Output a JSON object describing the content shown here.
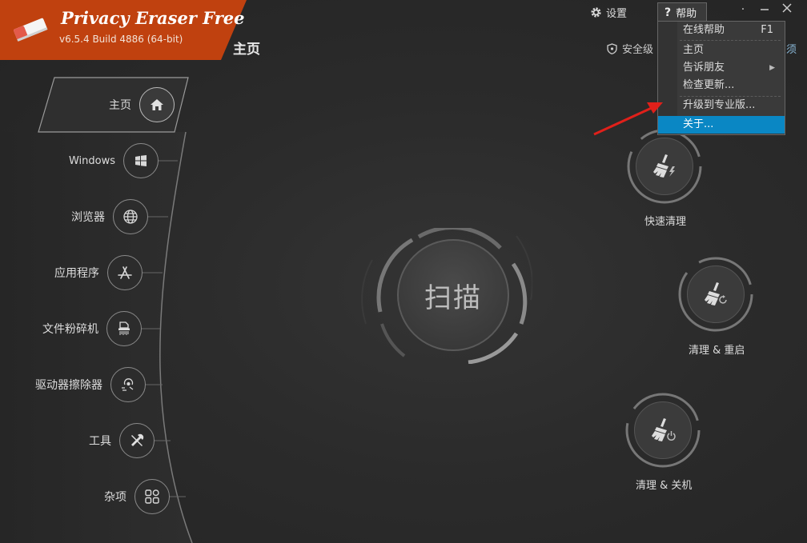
{
  "app": {
    "title": "Privacy Eraser Free",
    "version": "v6.5.4 Build 4886 (64-bit)",
    "brand_color": "#c0410f"
  },
  "header": {
    "page_title": "主页",
    "settings_label": "设置",
    "help_label": "帮助",
    "security_label": "安全级",
    "edge_text": "须"
  },
  "sidebar": {
    "items": [
      {
        "label": "主页",
        "icon": "home-icon",
        "active": true
      },
      {
        "label": "Windows",
        "icon": "windows-icon"
      },
      {
        "label": "浏览器",
        "icon": "globe-icon"
      },
      {
        "label": "应用程序",
        "icon": "app-store-icon"
      },
      {
        "label": "文件粉碎机",
        "icon": "shredder-icon"
      },
      {
        "label": "驱动器擦除器",
        "icon": "drive-wipe-icon"
      },
      {
        "label": "工具",
        "icon": "tools-icon"
      },
      {
        "label": "杂项",
        "icon": "grid-icon"
      }
    ]
  },
  "main": {
    "scan_label": "扫描",
    "actions": [
      {
        "label": "快速清理",
        "icon": "broom-lightning-icon"
      },
      {
        "label": "清理 & 重启",
        "icon": "broom-restart-icon"
      },
      {
        "label": "清理 & 关机",
        "icon": "broom-power-icon"
      }
    ]
  },
  "help_menu": {
    "items": [
      {
        "label": "在线帮助",
        "shortcut": "F1"
      },
      {
        "label": "主页"
      },
      {
        "label": "告诉朋友",
        "has_submenu": true
      },
      {
        "label": "检查更新..."
      },
      {
        "label": "升级到专业版..."
      },
      {
        "label": "关于...",
        "highlighted": true
      }
    ],
    "highlight_color": "#0a87c4"
  }
}
